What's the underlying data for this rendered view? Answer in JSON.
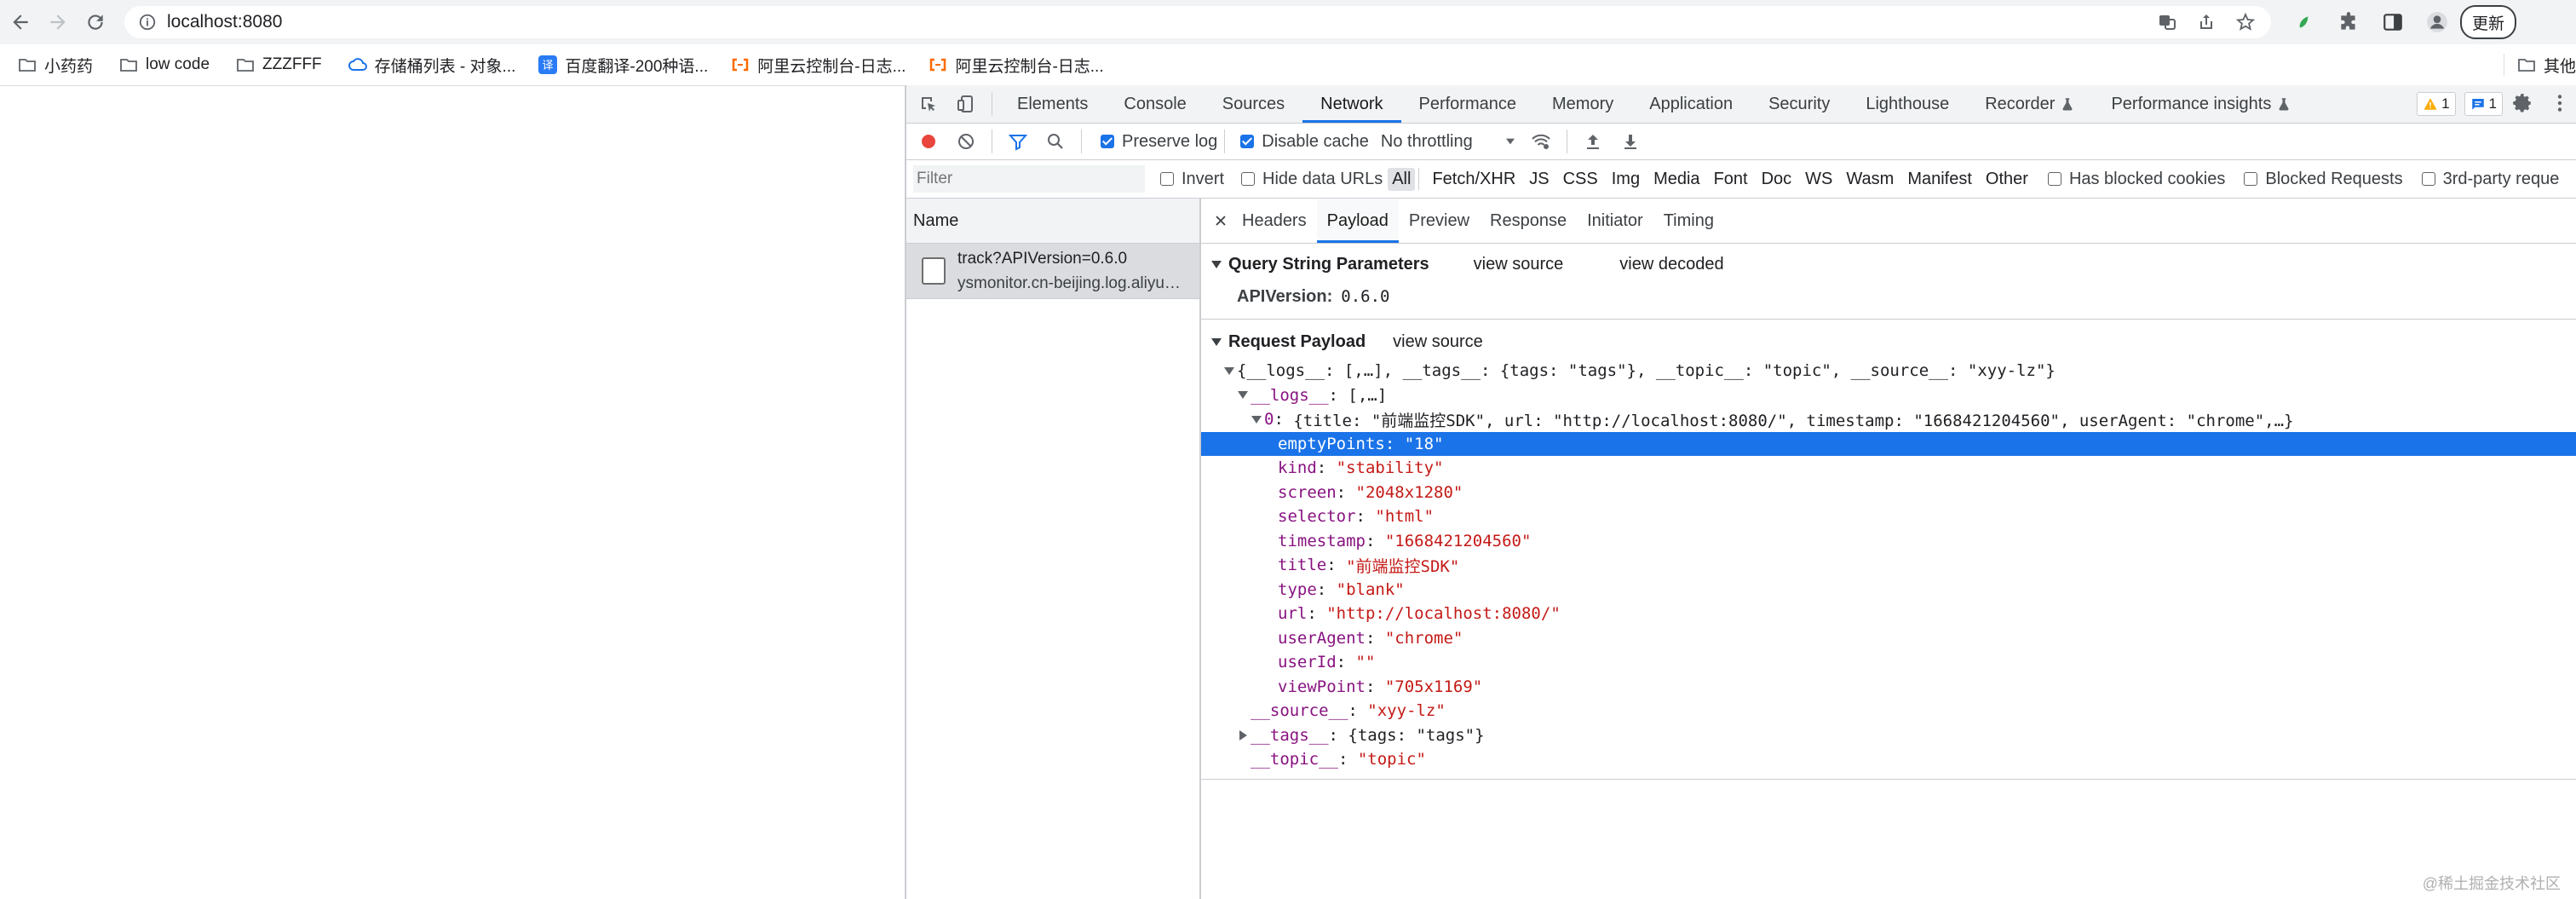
{
  "browser": {
    "url": "localhost:8080",
    "update_label": "更新",
    "bookmarks": [
      {
        "label": "小药药",
        "icon": "folder-icon"
      },
      {
        "label": "low code",
        "icon": "folder-icon"
      },
      {
        "label": "ZZZFFF",
        "icon": "folder-icon"
      },
      {
        "label": "存储桶列表 - 对象...",
        "icon": "cloud-icon"
      },
      {
        "label": "百度翻译-200种语...",
        "icon": "translate-icon"
      },
      {
        "label": "阿里云控制台-日志...",
        "icon": "aliyun-icon"
      },
      {
        "label": "阿里云控制台-日志...",
        "icon": "aliyun-icon"
      }
    ],
    "bookmarks_more": "其他"
  },
  "devtools": {
    "tabs": [
      "Elements",
      "Console",
      "Sources",
      "Network",
      "Performance",
      "Memory",
      "Application",
      "Security",
      "Lighthouse",
      "Recorder",
      "Performance insights"
    ],
    "active_tab": "Network",
    "warnings_count": "1",
    "messages_count": "1",
    "toolbar": {
      "preserve_log": "Preserve log",
      "disable_cache": "Disable cache",
      "throttling": "No throttling"
    },
    "filter_bar": {
      "placeholder": "Filter",
      "invert": "Invert",
      "hide_data_urls": "Hide data URLs",
      "types": [
        "All",
        "Fetch/XHR",
        "JS",
        "CSS",
        "Img",
        "Media",
        "Font",
        "Doc",
        "WS",
        "Wasm",
        "Manifest",
        "Other"
      ],
      "has_blocked_cookies": "Has blocked cookies",
      "blocked_requests": "Blocked Requests",
      "third_party": "3rd-party reque"
    },
    "request_list": {
      "header": "Name",
      "row_line1": "track?APIVersion=0.6.0",
      "row_line2": "ysmonitor.cn-beijing.log.aliyuncs.com/logstores"
    },
    "detail_tabs": [
      "Headers",
      "Payload",
      "Preview",
      "Response",
      "Initiator",
      "Timing"
    ],
    "active_detail_tab": "Payload",
    "query": {
      "title": "Query String Parameters",
      "view_source": "view source",
      "view_decoded": "view decoded",
      "param_key": "APIVersion:",
      "param_value": "0.6.0"
    },
    "payload": {
      "title": "Request Payload",
      "view_source": "view source",
      "root": "{__logs__: [,…], __tags__: {tags: \"tags\"}, __topic__: \"topic\", __source__: \"xyy-lz\"}",
      "logs_key": "__logs__",
      "logs_summary": "[,…]",
      "item0_key": "0",
      "item0_summary": "{title: \"前端监控SDK\", url: \"http://localhost:8080/\", timestamp: \"1668421204560\", userAgent: \"chrome\",…}",
      "fields": [
        {
          "key": "emptyPoints",
          "value": "\"18\""
        },
        {
          "key": "kind",
          "value": "\"stability\""
        },
        {
          "key": "screen",
          "value": "\"2048x1280\""
        },
        {
          "key": "selector",
          "value": "\"html\""
        },
        {
          "key": "timestamp",
          "value": "\"1668421204560\""
        },
        {
          "key": "title",
          "value": "\"前端监控SDK\""
        },
        {
          "key": "type",
          "value": "\"blank\""
        },
        {
          "key": "url",
          "value": "\"http://localhost:8080/\""
        },
        {
          "key": "userAgent",
          "value": "\"chrome\""
        },
        {
          "key": "userId",
          "value": "\"\""
        },
        {
          "key": "viewPoint",
          "value": "\"705x1169\""
        }
      ],
      "source_key": "__source__",
      "source_value": "\"xyy-lz\"",
      "tags_key": "__tags__",
      "tags_summary": "{tags: \"tags\"}",
      "topic_key": "__topic__",
      "topic_value": "\"topic\""
    }
  },
  "watermark": "@稀土掘金技术社区",
  "colors": {
    "accent": "#1a73e8",
    "record": "#e8453c",
    "json_key": "#881280",
    "json_string": "#c41a16"
  }
}
